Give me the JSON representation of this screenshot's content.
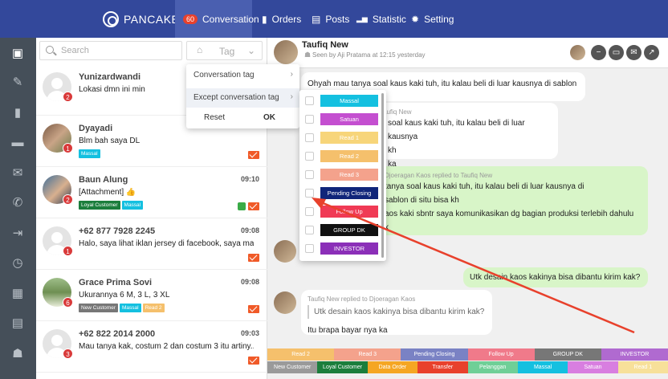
{
  "nav": {
    "brand": "PANCAKE",
    "conversation_badge": "60",
    "conversation": "Conversation",
    "orders": "Orders",
    "posts": "Posts",
    "statistic": "Statistic",
    "setting": "Setting"
  },
  "list": {
    "search_placeholder": "Search",
    "tag_label": "Tag"
  },
  "conversations": [
    {
      "name": "Yunizardwandi",
      "msg": "Lokasi dmn ini min",
      "time": "",
      "count": "2",
      "tags": []
    },
    {
      "name": "Dyayadi",
      "msg": "Blm bah saya DL",
      "time": "",
      "count": "1",
      "tags": [
        {
          "label": "Massal",
          "color": "#14c0e0"
        }
      ]
    },
    {
      "name": "Baun Alung",
      "msg": "[Attachment] 👍",
      "time": "09:10",
      "count": "2",
      "tags": [
        {
          "label": "Loyal Customer",
          "color": "#1b7e3c"
        },
        {
          "label": "Massal",
          "color": "#14c0e0"
        }
      ]
    },
    {
      "name": "+62 877 7928 2245",
      "msg": "Halo, saya lihat iklan jersey di facebook, saya ma...",
      "time": "09:08",
      "count": "1",
      "tags": []
    },
    {
      "name": "Grace Prima Sovi",
      "msg": "Ukurannya 6 M, 3 L, 3 XL",
      "time": "09:08",
      "count": "6",
      "tags": [
        {
          "label": "New Customer",
          "color": "#777"
        },
        {
          "label": "Massal",
          "color": "#14c0e0"
        },
        {
          "label": "Read 2",
          "color": "#f5c06c"
        }
      ]
    },
    {
      "name": "+62 822 2014 2000",
      "msg": "Mau tanya kak, costum 2 dan costum 3 itu artiny...",
      "time": "09:03",
      "count": "3",
      "tags": []
    }
  ],
  "menu": {
    "item1": "Conversation tag",
    "item2": "Except conversation tag",
    "reset": "Reset",
    "ok": "OK"
  },
  "tag_options": [
    {
      "label": "Massal",
      "color": "#14c0e0"
    },
    {
      "label": "Satuan",
      "color": "#c44fd0"
    },
    {
      "label": "Read 1",
      "color": "#f7d57a"
    },
    {
      "label": "Read 2",
      "color": "#f5c06c"
    },
    {
      "label": "Read 3",
      "color": "#f4a28c"
    },
    {
      "label": "Pending Closing",
      "color": "#10257a"
    },
    {
      "label": "Follow Up",
      "color": "#f03a55"
    },
    {
      "label": "GROUP DK",
      "color": "#111111"
    },
    {
      "label": "INVESTOR",
      "color": "#8b2fb8"
    }
  ],
  "chat": {
    "name": "Taufiq New",
    "seen": "Seen by Aji Pratama at 12:15 yesterday",
    "msg1": "Ohyah mau tanya soal kaus kaki tuh, itu kalau beli di luar kausnya di sablon",
    "msg1b": "di situ bisa kh",
    "q2": "Taufiq New",
    "msg2": "soal kaus kaki tuh, itu kalau beli di luar kausnya",
    "msg2b": "kh",
    "msg2c": "ka",
    "q3": "Djoeragan Kaos replied to Taufiq New",
    "q3text": "tanya soal kaus kaki tuh, itu kalau beli di luar kausnya di",
    "q3text2": "sablon di situ bisa kh",
    "msg3": "aos kaki sbntr saya komunikasikan dg bagian produksi terlebih dahulu",
    "msg3b": "k",
    "msg4": "Utk desain kaos kakinya bisa dibantu kirim kak?",
    "q5": "Taufiq New replied to Djoeragan Kaos",
    "q5text": "Utk desain kaos kakinya bisa dibantu kirim kak?",
    "msg5": "Itu brapa bayar nya ka"
  },
  "bottom_row1": [
    {
      "label": "Read 2",
      "color": "#f5c06c"
    },
    {
      "label": "Read 3",
      "color": "#f4a28c"
    },
    {
      "label": "Pending Closing",
      "color": "#7a82c4"
    },
    {
      "label": "Follow Up",
      "color": "#f07a8a"
    },
    {
      "label": "GROUP DK",
      "color": "#777777"
    },
    {
      "label": "INVESTOR",
      "color": "#b06ad0"
    }
  ],
  "bottom_row2": [
    {
      "label": "New Customer",
      "color": "#9a9a9a"
    },
    {
      "label": "Loyal Customer",
      "color": "#1b7e3c"
    },
    {
      "label": "Data Order",
      "color": "#f5a623"
    },
    {
      "label": "Transfer",
      "color": "#e8412c"
    },
    {
      "label": "Pelanggan",
      "color": "#6fcf97"
    },
    {
      "label": "Massal",
      "color": "#14c0e0"
    },
    {
      "label": "Satuan",
      "color": "#d87ee0"
    },
    {
      "label": "Read 1",
      "color": "#f7e09a"
    }
  ]
}
